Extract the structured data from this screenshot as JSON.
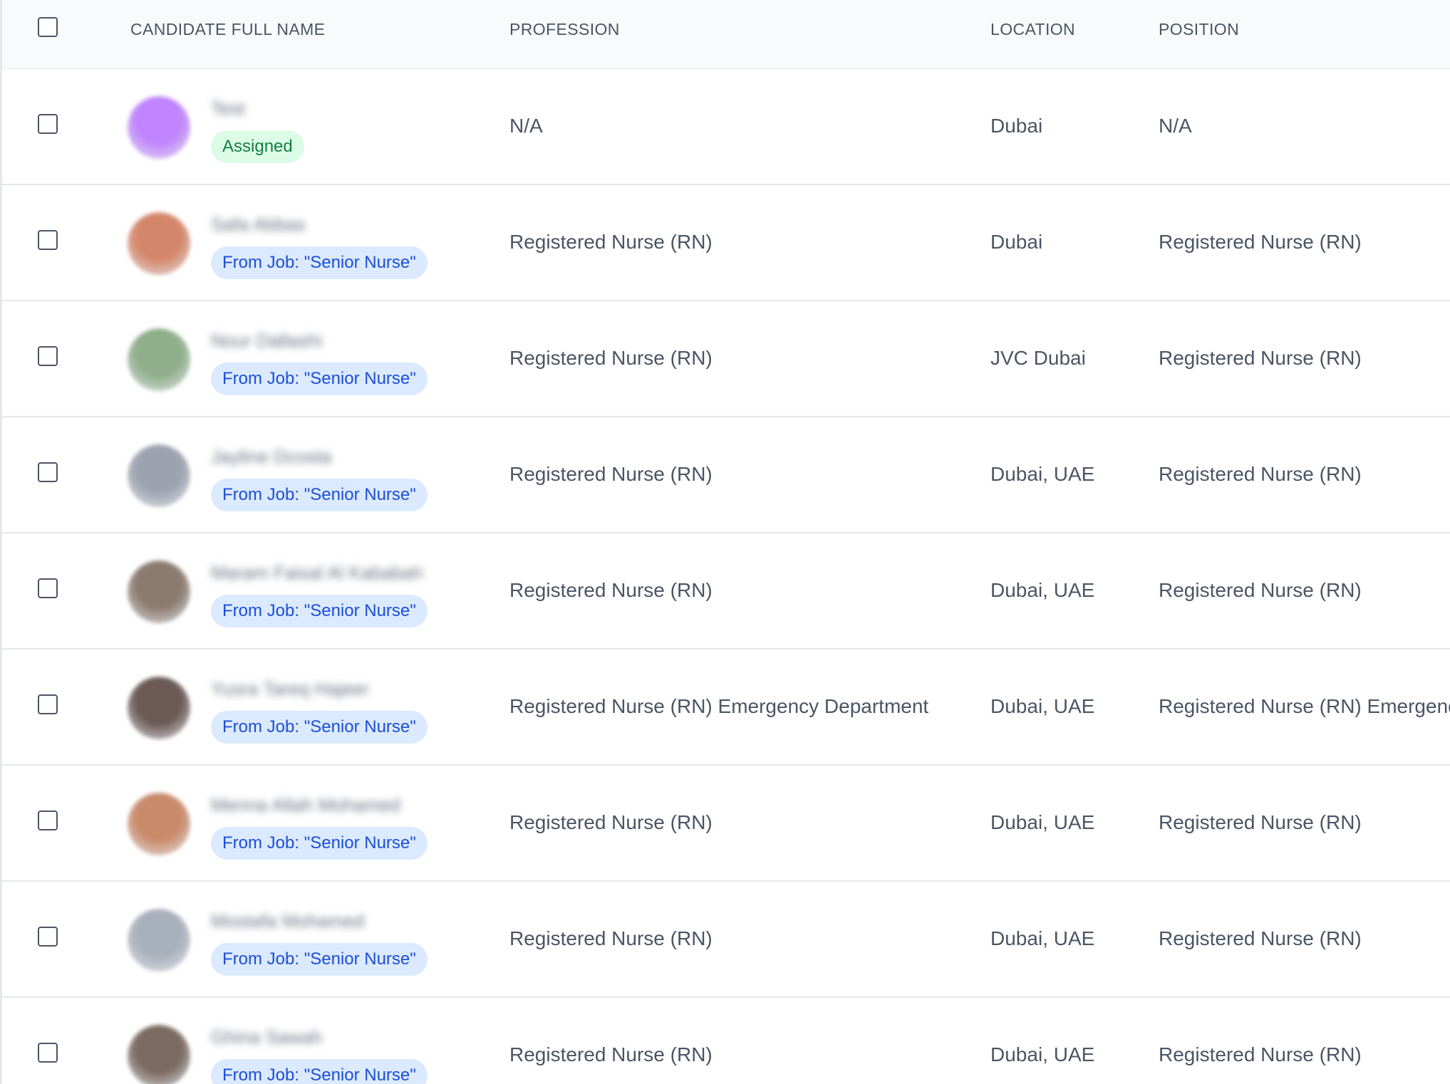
{
  "columns": {
    "name": "CANDIDATE FULL NAME",
    "profession": "PROFESSION",
    "location": "LOCATION",
    "position": "POSITION"
  },
  "rows": [
    {
      "name": "Test",
      "badge": "Assigned",
      "badge_type": "green",
      "profession": "N/A",
      "location": "Dubai",
      "position": "N/A",
      "avatar_color": "#c084fc"
    },
    {
      "name": "Safa Abbas",
      "badge": "From Job: \"Senior Nurse\"",
      "badge_type": "blue",
      "profession": "Registered Nurse (RN)",
      "location": "Dubai",
      "position": "Registered Nurse (RN)",
      "avatar_color": "#d4866a"
    },
    {
      "name": "Nour Dallashi",
      "badge": "From Job: \"Senior Nurse\"",
      "badge_type": "blue",
      "profession": "Registered Nurse (RN)",
      "location": "JVC Dubai",
      "position": "Registered Nurse (RN)",
      "avatar_color": "#8fae8a"
    },
    {
      "name": "Jayline Dcosta",
      "badge": "From Job: \"Senior Nurse\"",
      "badge_type": "blue",
      "profession": "Registered Nurse (RN)",
      "location": "Dubai, UAE",
      "position": "Registered Nurse (RN)",
      "avatar_color": "#9ca3af"
    },
    {
      "name": "Maram Faisal Al Kababah",
      "badge": "From Job: \"Senior Nurse\"",
      "badge_type": "blue",
      "profession": "Registered Nurse (RN)",
      "location": "Dubai, UAE",
      "position": "Registered Nurse (RN)",
      "avatar_color": "#8b7b6e"
    },
    {
      "name": "Yusra Tareq Hajeer",
      "badge": "From Job: \"Senior Nurse\"",
      "badge_type": "blue",
      "profession": "Registered Nurse (RN) Emergency Department",
      "location": "Dubai, UAE",
      "position": "Registered Nurse (RN) Emergency",
      "avatar_color": "#6b5a55"
    },
    {
      "name": "Menna Allah Mohamed",
      "badge": "From Job: \"Senior Nurse\"",
      "badge_type": "blue",
      "profession": "Registered Nurse (RN)",
      "location": "Dubai, UAE",
      "position": "Registered Nurse (RN)",
      "avatar_color": "#c98a6a"
    },
    {
      "name": "Mostafa Mohamed",
      "badge": "From Job: \"Senior Nurse\"",
      "badge_type": "blue",
      "profession": "Registered Nurse (RN)",
      "location": "Dubai, UAE",
      "position": "Registered Nurse (RN)",
      "avatar_color": "#a8b0bb"
    },
    {
      "name": "Ghina Sawah",
      "badge": "From Job: \"Senior Nurse\"",
      "badge_type": "blue",
      "profession": "Registered Nurse (RN)",
      "location": "Dubai, UAE",
      "position": "Registered Nurse (RN)",
      "avatar_color": "#7a6a60"
    }
  ]
}
